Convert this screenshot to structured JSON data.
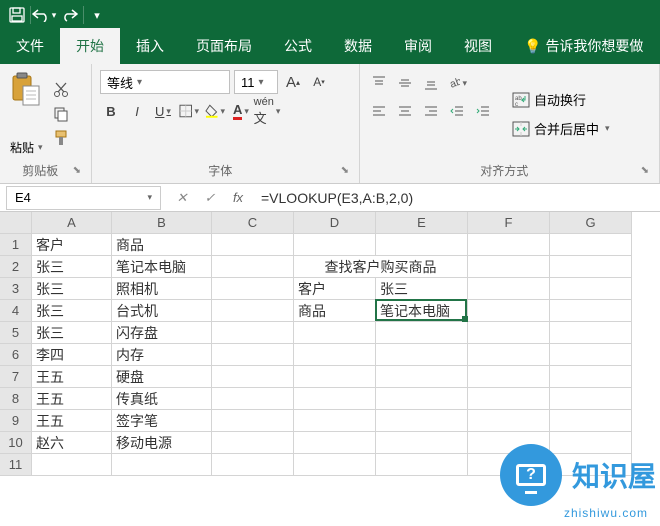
{
  "titlebar": {
    "save": "💾",
    "undo": "↶",
    "redo": "↷"
  },
  "tabs": {
    "file": "文件",
    "home": "开始",
    "insert": "插入",
    "layout": "页面布局",
    "formulas": "公式",
    "data": "数据",
    "review": "审阅",
    "view": "视图",
    "tell_me": "告诉我你想要做"
  },
  "ribbon": {
    "paste": "粘贴",
    "clipboard_group": "剪贴板",
    "font_name": "等线",
    "font_size": "11",
    "font_group": "字体",
    "align_group": "对齐方式",
    "wrap_text": "自动换行",
    "merge_center": "合并后居中"
  },
  "namebox": "E4",
  "formula": "=VLOOKUP(E3,A:B,2,0)",
  "columns": [
    "A",
    "B",
    "C",
    "D",
    "E",
    "F",
    "G"
  ],
  "rows": [
    "1",
    "2",
    "3",
    "4",
    "5",
    "6",
    "7",
    "8",
    "9",
    "10",
    "11"
  ],
  "cells": {
    "A1": "客户",
    "B1": "商品",
    "A2": "张三",
    "B2": "笔记本电脑",
    "D2E2": "查找客户购买商品",
    "A3": "张三",
    "B3": "照相机",
    "D3": "客户",
    "E3": "张三",
    "A4": "张三",
    "B4": "台式机",
    "D4": "商品",
    "E4": "笔记本电脑",
    "A5": "张三",
    "B5": "闪存盘",
    "A6": "李四",
    "B6": "内存",
    "A7": "王五",
    "B7": "硬盘",
    "A8": "王五",
    "B8": "传真纸",
    "A9": "王五",
    "B9": "签字笔",
    "A10": "赵六",
    "B10": "移动电源"
  },
  "watermark": {
    "text": "知识屋",
    "sub": "zhishiwu.com",
    "q": "?"
  }
}
